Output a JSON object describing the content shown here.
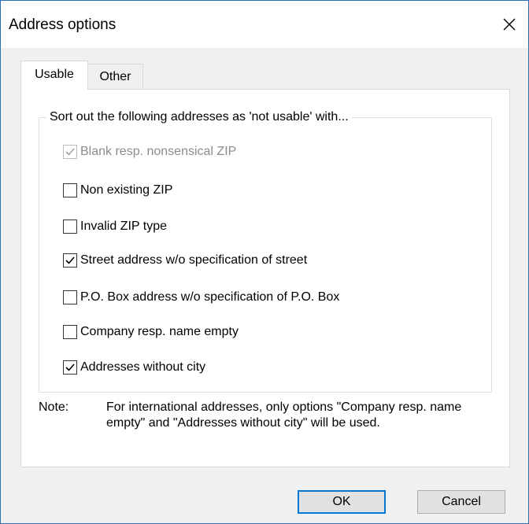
{
  "window": {
    "title": "Address options"
  },
  "tabs": [
    {
      "label": "Usable",
      "selected": true
    },
    {
      "label": "Other",
      "selected": false
    }
  ],
  "group": {
    "legend": "Sort out the following addresses as 'not usable' with..."
  },
  "options": [
    {
      "label": "Blank resp. nonsensical ZIP",
      "checked": true,
      "enabled": false
    },
    {
      "label": "Non existing ZIP",
      "checked": false,
      "enabled": true
    },
    {
      "label": "Invalid ZIP type",
      "checked": false,
      "enabled": true
    },
    {
      "label": "Street address w/o specification of street",
      "checked": true,
      "enabled": true
    },
    {
      "label": "P.O. Box address w/o specification of P.O. Box",
      "checked": false,
      "enabled": true
    },
    {
      "label": "Company resp. name empty",
      "checked": false,
      "enabled": true
    },
    {
      "label": "Addresses without city",
      "checked": true,
      "enabled": true
    }
  ],
  "note": {
    "label": "Note:",
    "text": "For international addresses, only options \"Company resp. name empty\" and \"Addresses without city\" will be used."
  },
  "buttons": {
    "ok": "OK",
    "cancel": "Cancel"
  },
  "icons": {
    "close": "close-icon",
    "check": "checkmark-icon"
  },
  "colors": {
    "window_border": "#2a6db8",
    "client_bg": "#f0f0f0",
    "default_button_border": "#0078d7",
    "disabled_text": "#8c8c8c"
  }
}
